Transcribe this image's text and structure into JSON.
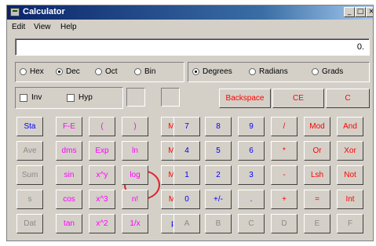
{
  "window": {
    "title": "Calculator"
  },
  "title_buttons": {
    "minimize": "_",
    "maximize": "□",
    "close": "×"
  },
  "menu": [
    "Edit",
    "View",
    "Help"
  ],
  "display": {
    "value": "0."
  },
  "base_radios": [
    {
      "label": "Hex",
      "selected": false
    },
    {
      "label": "Dec",
      "selected": true
    },
    {
      "label": "Oct",
      "selected": false
    },
    {
      "label": "Bin",
      "selected": false
    }
  ],
  "angle_radios": [
    {
      "label": "Degrees",
      "selected": true
    },
    {
      "label": "Radians",
      "selected": false
    },
    {
      "label": "Grads",
      "selected": false
    }
  ],
  "checkboxes": [
    {
      "label": "Inv",
      "checked": false
    },
    {
      "label": "Hyp",
      "checked": false
    }
  ],
  "clear_buttons": [
    "Backspace",
    "CE",
    "C"
  ],
  "keys": [
    [
      "Sta",
      "F-E",
      "(",
      ")",
      "MC",
      "7",
      "8",
      "9",
      "/",
      "Mod",
      "And"
    ],
    [
      "Ave",
      "dms",
      "Exp",
      "ln",
      "MR",
      "4",
      "5",
      "6",
      "*",
      "Or",
      "Xor"
    ],
    [
      "Sum",
      "sin",
      "x^y",
      "log",
      "MS",
      "1",
      "2",
      "3",
      "-",
      "Lsh",
      "Not"
    ],
    [
      "s",
      "cos",
      "x^3",
      "n!",
      "M+",
      "0",
      "+/-",
      ".",
      "+",
      "=",
      "Int"
    ],
    [
      "Dat",
      "tan",
      "x^2",
      "1/x",
      "pi",
      "A",
      "B",
      "C",
      "D",
      "E",
      "F"
    ]
  ],
  "highlight": {
    "key": "log",
    "color": "#e0242a"
  }
}
